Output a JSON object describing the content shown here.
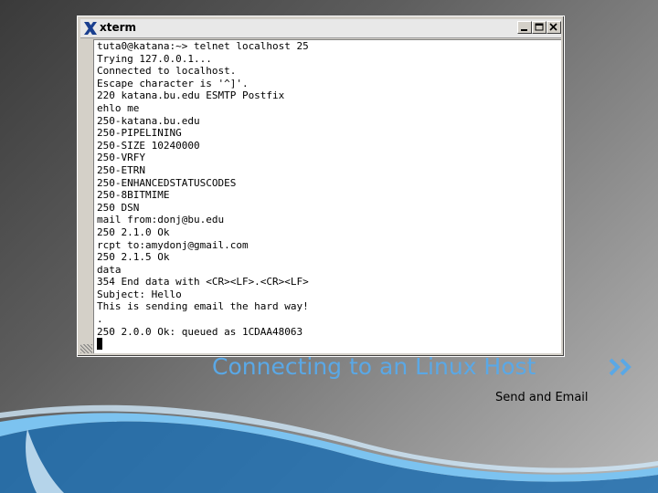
{
  "window": {
    "title": "xterm",
    "buttons": [
      "minimize",
      "maximize",
      "close"
    ]
  },
  "terminal": {
    "lines": [
      "tuta0@katana:~> telnet localhost 25",
      "Trying 127.0.0.1...",
      "Connected to localhost.",
      "Escape character is '^]'.",
      "220 katana.bu.edu ESMTP Postfix",
      "ehlo me",
      "250-katana.bu.edu",
      "250-PIPELINING",
      "250-SIZE 10240000",
      "250-VRFY",
      "250-ETRN",
      "250-ENHANCEDSTATUSCODES",
      "250-8BITMIME",
      "250 DSN",
      "mail from:donj@bu.edu",
      "250 2.1.0 Ok",
      "rcpt to:amydonj@gmail.com",
      "250 2.1.5 Ok",
      "data",
      "354 End data with <CR><LF>.<CR><LF>",
      "Subject: Hello",
      "This is sending email the hard way!",
      ".",
      "250 2.0.0 Ok: queued as 1CDAA48063"
    ]
  },
  "slide": {
    "title": "Connecting to an Linux Host",
    "subtitle": "Send and Email"
  },
  "colors": {
    "title_accent": "#5aa8e6",
    "swoosh": "#3a8fd0"
  }
}
